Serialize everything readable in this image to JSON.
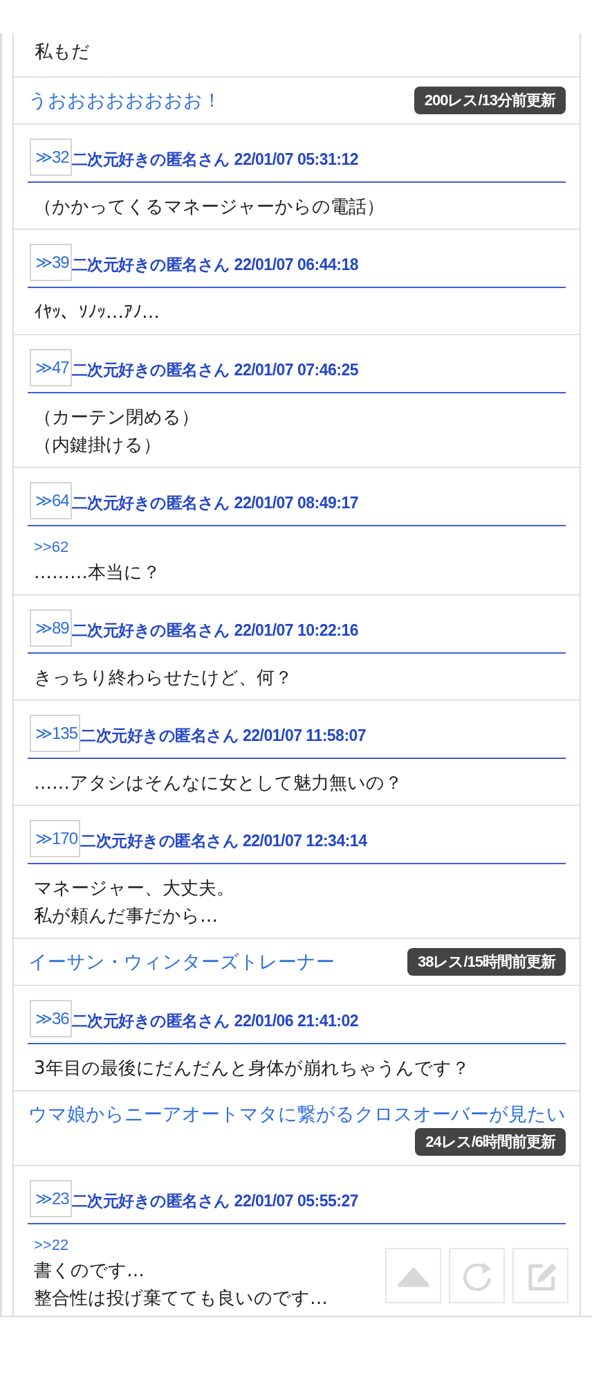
{
  "items": [
    {
      "kind": "message",
      "lines": [
        "私もだ"
      ]
    },
    {
      "kind": "thread",
      "title": "うおおおおおおおお！",
      "badge": "200レス/13分前更新"
    },
    {
      "kind": "post",
      "number": "≫32",
      "header": "二次元好きの匿名さん 22/01/07 05:31:12",
      "lines": [
        "（かかってくるマネージャーからの電話）"
      ]
    },
    {
      "kind": "post",
      "number": "≫39",
      "header": "二次元好きの匿名さん 22/01/07 06:44:18",
      "lines": [
        "ｲﾔｯ、ｿﾉｯ…ｱﾉ…"
      ]
    },
    {
      "kind": "post",
      "number": "≫47",
      "header": "二次元好きの匿名さん 22/01/07 07:46:25",
      "lines": [
        "（カーテン閉める）",
        "（内鍵掛ける）"
      ]
    },
    {
      "kind": "post",
      "number": "≫64",
      "header": "二次元好きの匿名さん 22/01/07 08:49:17",
      "reply": ">>62",
      "lines": [
        "………本当に？"
      ]
    },
    {
      "kind": "post",
      "number": "≫89",
      "header": "二次元好きの匿名さん 22/01/07 10:22:16",
      "lines": [
        "きっちり終わらせたけど、何？"
      ]
    },
    {
      "kind": "post",
      "number": "≫135",
      "header": "二次元好きの匿名さん 22/01/07 11:58:07",
      "lines": [
        "……アタシはそんなに女として魅力無いの？"
      ]
    },
    {
      "kind": "post",
      "number": "≫170",
      "header": "二次元好きの匿名さん 22/01/07 12:34:14",
      "lines": [
        "マネージャー、大丈夫。",
        "私が頼んだ事だから…"
      ]
    },
    {
      "kind": "thread",
      "title": "イーサン・ウィンターズトレーナー",
      "badge": "38レス/15時間前更新"
    },
    {
      "kind": "post",
      "number": "≫36",
      "header": "二次元好きの匿名さん 22/01/06 21:41:02",
      "lines": [
        "3年目の最後にだんだんと身体が崩れちゃうんです？"
      ]
    },
    {
      "kind": "thread",
      "title": "ウマ娘からニーアオートマタに繋がるクロスオーバーが見たい",
      "badge": "24レス/6時間前更新"
    },
    {
      "kind": "post",
      "number": "≫23",
      "header": "二次元好きの匿名さん 22/01/07 05:55:27",
      "reply": ">>22",
      "lines": [
        "書くのです…",
        "整合性は投げ棄てても良いのです…"
      ]
    }
  ],
  "float_buttons": [
    {
      "kind": "top"
    },
    {
      "kind": "reload"
    },
    {
      "kind": "write"
    }
  ]
}
